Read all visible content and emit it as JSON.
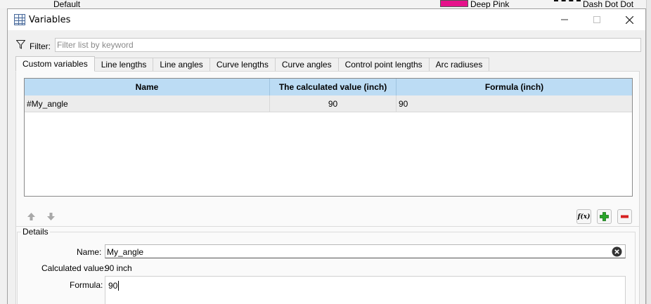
{
  "background_app": {
    "preset_label": "Default",
    "color_label": "Deep Pink",
    "color_swatch": "#e6128b",
    "line_style_label": "Dash Dot Dot"
  },
  "window": {
    "title": "Variables",
    "icon": "table-grid-icon"
  },
  "filter": {
    "label": "Filter:",
    "placeholder": "Filter list by keyword",
    "value": ""
  },
  "tabs": [
    {
      "label": "Custom variables",
      "active": true
    },
    {
      "label": "Line lengths",
      "active": false
    },
    {
      "label": "Line angles",
      "active": false
    },
    {
      "label": "Curve lengths",
      "active": false
    },
    {
      "label": "Curve angles",
      "active": false
    },
    {
      "label": "Control point lengths",
      "active": false
    },
    {
      "label": "Arc radiuses",
      "active": false
    }
  ],
  "table": {
    "columns": [
      "Name",
      "The calculated value (inch)",
      "Formula (inch)"
    ],
    "header_color": "#bcdcf4",
    "rows": [
      {
        "name": "#My_angle",
        "value": "90",
        "formula": "90"
      }
    ]
  },
  "toolbar": {
    "icons": [
      "move-up-icon",
      "move-down-icon",
      "formula-fx-icon",
      "add-plus-icon",
      "remove-minus-icon"
    ],
    "fx_label": "f(x)"
  },
  "details": {
    "legend": "Details",
    "name_label": "Name:",
    "name_value": "My_angle",
    "calc_label": "Calculated value:",
    "calc_value": "90 inch",
    "formula_label": "Formula:",
    "formula_value": "90"
  }
}
